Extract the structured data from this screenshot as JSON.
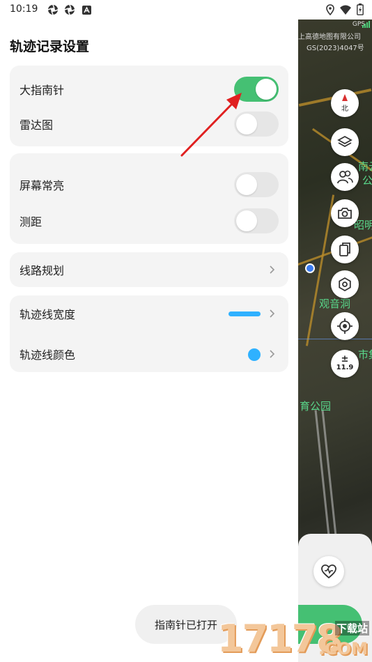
{
  "status_bar": {
    "time": "10:19",
    "left_icons": [
      "aperture-icon",
      "aperture-icon",
      "text-icon"
    ],
    "right_icons": [
      "location-icon",
      "wifi-icon",
      "battery-icon"
    ]
  },
  "page": {
    "title": "轨迹记录设置"
  },
  "settings": {
    "group1": [
      {
        "label": "大指南针",
        "toggle_on": true
      },
      {
        "label": "雷达图",
        "toggle_on": false
      }
    ],
    "group2": [
      {
        "label": "屏幕常亮",
        "toggle_on": false
      },
      {
        "label": "测距",
        "toggle_on": false
      }
    ],
    "route_planning": {
      "label": "线路规划"
    },
    "line_width": {
      "label": "轨迹线宽度"
    },
    "line_color": {
      "label": "轨迹线颜色"
    }
  },
  "colors": {
    "accent_green": "#45c073",
    "track_line_color": "#2fb1ff"
  },
  "map": {
    "gps_label": "GPS",
    "copyright_line1": "上高德地图有限公司",
    "copyright_line2": "GS(2023)4047号",
    "compass_label": "北",
    "zoom_label": "11.9",
    "zoom_symbol": "±",
    "place_labels": [
      "南云",
      "公",
      "昭明",
      "观音洞",
      "市集",
      "育公园"
    ],
    "buttons": [
      "compass-icon",
      "layers-icon",
      "users-icon",
      "camera-icon",
      "copy-icon",
      "settings-icon",
      "locate-icon",
      "zoom-icon",
      "heart-icon"
    ]
  },
  "toast": {
    "text": "指南针已打开"
  },
  "watermark": {
    "number": "17178",
    "tag": "下载站",
    "domain": ".COM"
  }
}
